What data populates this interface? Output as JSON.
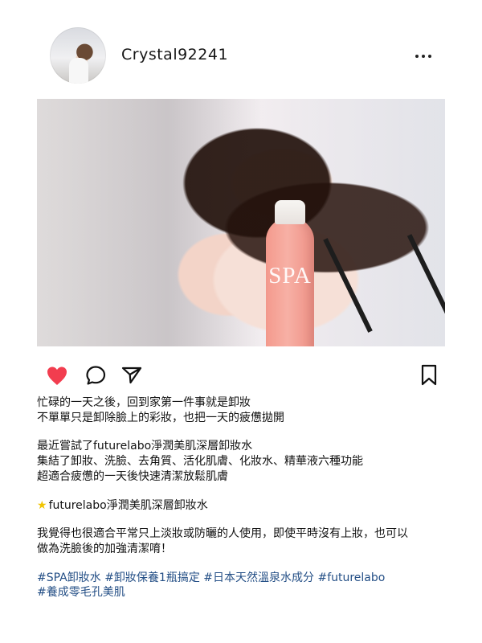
{
  "header": {
    "username": "Crystal92241"
  },
  "post": {
    "bottle_brand": "SPA"
  },
  "caption": {
    "lines": [
      "忙碌的一天之後，回到家第一件事就是卸妝",
      "不單單只是卸除臉上的彩妝，也把一天的疲憊拋開",
      "最近嘗試了futurelabo淨潤美肌深層卸妝水",
      "集結了卸妝、洗臉、去角質、活化肌膚、化妝水、精華液六種功能",
      "超適合疲憊的一天後快速清潔放鬆肌膚",
      "futurelabo淨潤美肌深層卸妝水",
      "我覺得也很適合平常只上淡妝或防曬的人使用，即使平時沒有上妝，也可以",
      "做為洗臉後的加強清潔唷！"
    ],
    "hashtags": [
      "#SPA卸妝水 #卸妝保養1瓶搞定 #日本天然溫泉水成分 #futurelabo",
      "#養成零毛孔美肌"
    ]
  },
  "icons": {
    "like": "heart-icon",
    "comment": "comment-icon",
    "share": "send-icon",
    "save": "bookmark-icon",
    "more": "more-icon"
  },
  "colors": {
    "heart": "#f23d4f",
    "hashtag": "#244f86",
    "star": "#f1c400"
  }
}
